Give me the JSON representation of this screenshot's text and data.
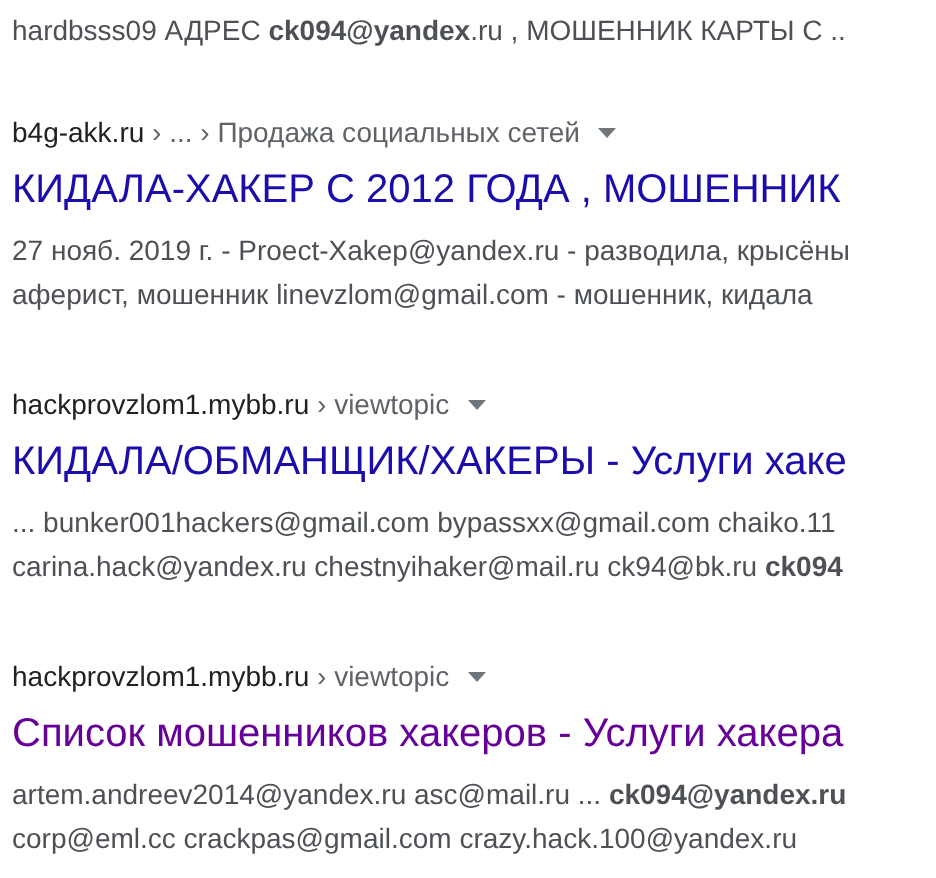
{
  "top_snippet": "hardbsss09 АДРЕС **ck094@yandex**.ru , МОШЕННИК КАРТЫ С ..",
  "results": [
    {
      "site": "b4g-akk.ru",
      "path": "› ... › Продажа социальных сетей",
      "title": "КИДАЛА-ХАКЕР С 2012 ГОДА , МОШЕННИК",
      "visited": false,
      "snippet": [
        "27 нояб. 2019 г. - Proect-Xakep@yandex.ru - разводила, крысёны",
        "аферист, мошенник linevzlom@gmail.com - мошенник, кидала"
      ]
    },
    {
      "site": "hackprovzlom1.mybb.ru",
      "path": "› viewtopic",
      "title": "КИДАЛА/ОБМАНЩИК/ХАКЕРЫ - Услуги хаке",
      "visited": false,
      "snippet": [
        "... bunker001hackers@gmail.com bypassxx@gmail.com chaiko.11",
        "carina.hack@yandex.ru chestnyihaker@mail.ru ck94@bk.ru **ck094**"
      ]
    },
    {
      "site": "hackprovzlom1.mybb.ru",
      "path": "› viewtopic",
      "title": "Список мошенников хакеров - Услуги хакера",
      "visited": true,
      "snippet": [
        "artem.andreev2014@yandex.ru asc@mail.ru ... **ck094@yandex.ru**",
        "corp@eml.cc crackpas@gmail.com crazy.hack.100@yandex.ru"
      ]
    }
  ]
}
